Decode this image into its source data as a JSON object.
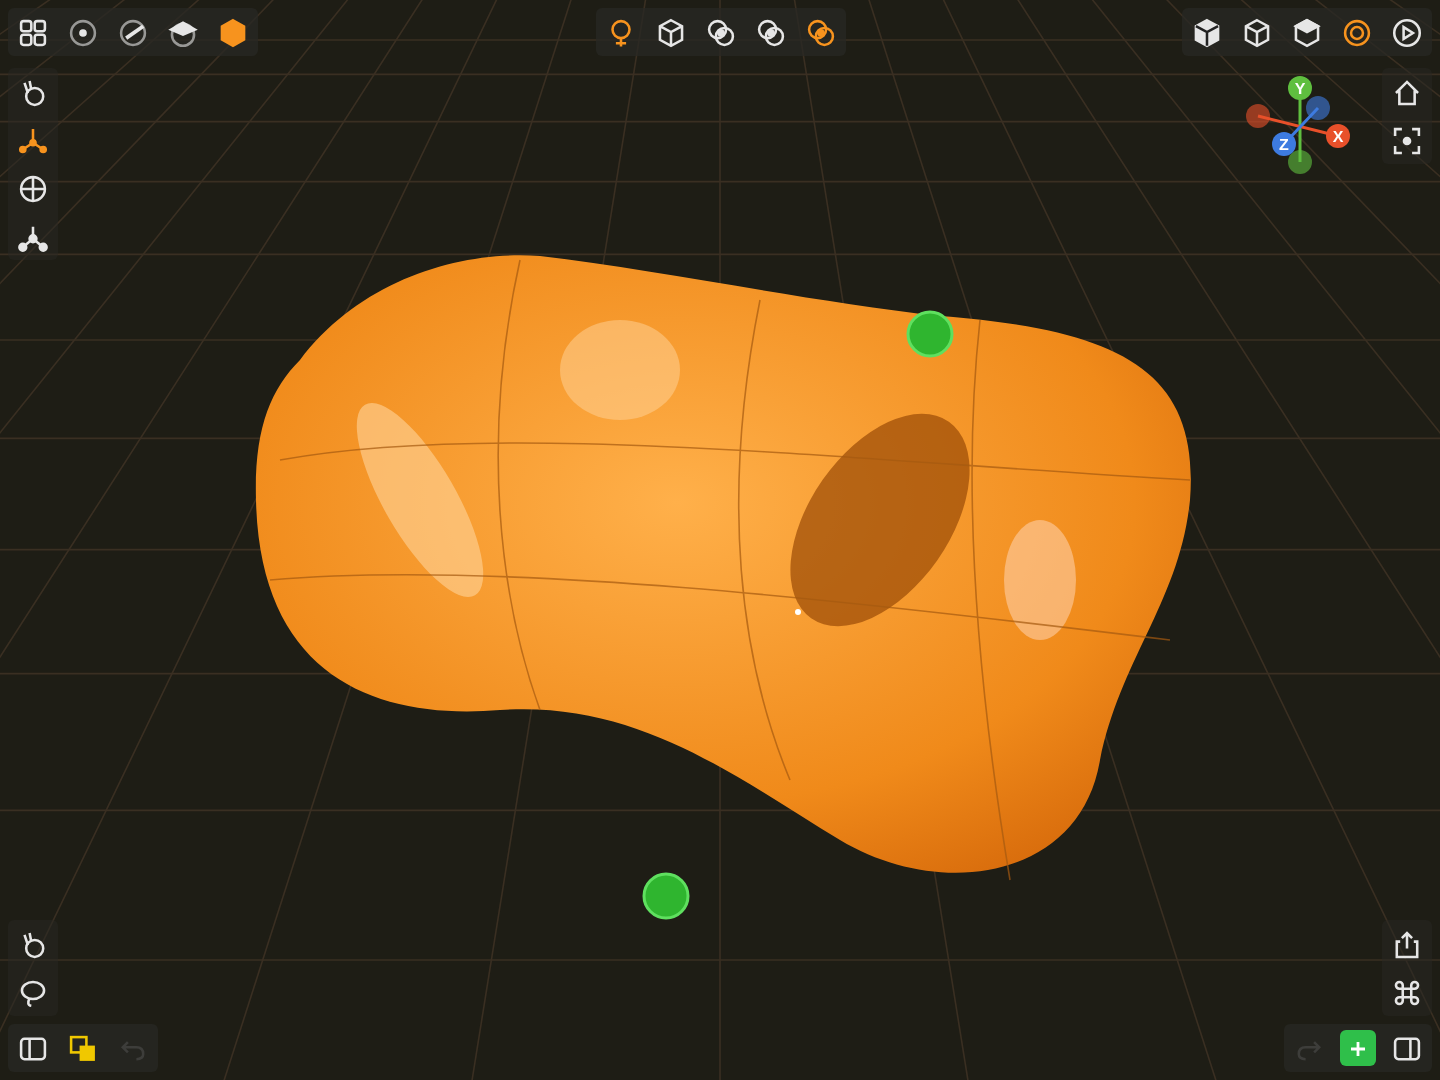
{
  "top_left": [
    {
      "kind": "grid",
      "active": false
    },
    {
      "kind": "sphere-dot",
      "active": false
    },
    {
      "kind": "sphere-slash",
      "active": false
    },
    {
      "kind": "sphere-cap",
      "active": false
    },
    {
      "kind": "hexagon",
      "active": true
    }
  ],
  "top_center": [
    {
      "kind": "lasso-hand",
      "active": true
    },
    {
      "kind": "cube-wire",
      "active": false
    },
    {
      "kind": "rings-one",
      "active": false
    },
    {
      "kind": "rings-two",
      "active": false
    },
    {
      "kind": "rings-pick",
      "active": true
    }
  ],
  "top_right": [
    {
      "kind": "cube-solid",
      "active": false
    },
    {
      "kind": "cube-wire",
      "active": false
    },
    {
      "kind": "cube-cap",
      "active": false
    },
    {
      "kind": "target",
      "active": true
    },
    {
      "kind": "play",
      "active": false
    }
  ],
  "left_tools": [
    {
      "kind": "hand-touch",
      "active": false
    },
    {
      "kind": "move-axes",
      "active": true
    },
    {
      "kind": "globe",
      "active": false
    },
    {
      "kind": "nodes",
      "active": false
    }
  ],
  "right_tools": [
    {
      "kind": "home",
      "active": false
    },
    {
      "kind": "focus",
      "active": false
    }
  ],
  "gizmo": {
    "axes": [
      {
        "label": "Y",
        "color": "#5fbf3f"
      },
      {
        "label": "X",
        "color": "#e8502a"
      },
      {
        "label": "Z",
        "color": "#3d7be0"
      }
    ]
  },
  "bottom_left_tools": [
    {
      "kind": "hand-touch",
      "active": false
    },
    {
      "kind": "lasso",
      "active": false
    }
  ],
  "bottom_left_bar": [
    {
      "kind": "sidebar",
      "disabled": false
    },
    {
      "kind": "color-swatch",
      "disabled": false
    },
    {
      "kind": "undo",
      "disabled": true
    }
  ],
  "bottom_right_tools": [
    {
      "kind": "share",
      "active": false
    },
    {
      "kind": "command",
      "active": false
    }
  ],
  "bottom_right_bar": [
    {
      "kind": "redo",
      "disabled": true
    },
    {
      "kind": "add",
      "disabled": false
    },
    {
      "kind": "panel",
      "disabled": false
    }
  ]
}
